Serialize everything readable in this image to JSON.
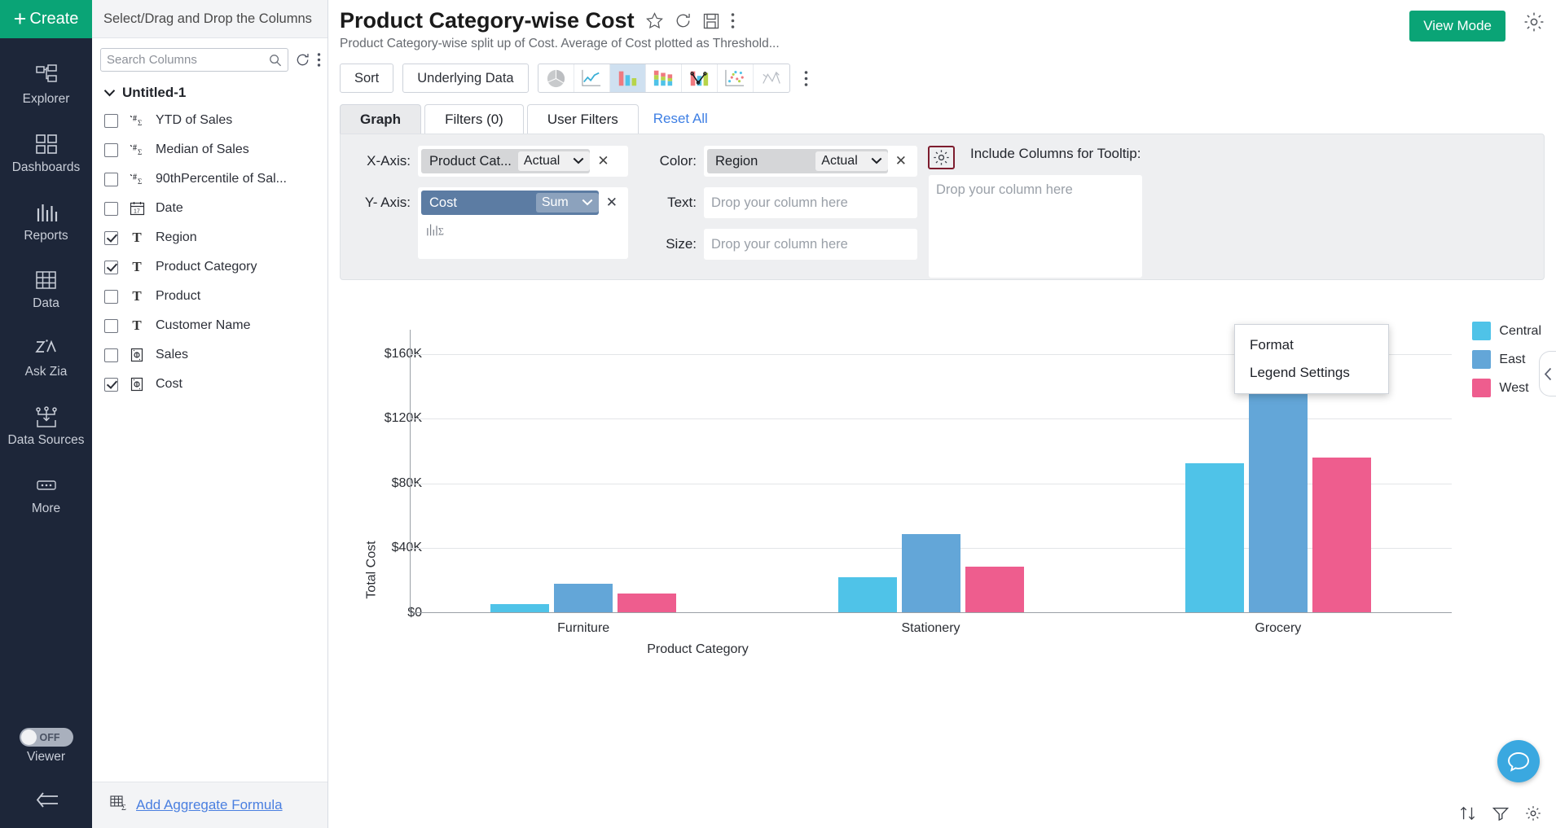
{
  "nav": {
    "create_label": "Create",
    "items": [
      {
        "label": "Explorer",
        "icon": "explorer-icon"
      },
      {
        "label": "Dashboards",
        "icon": "dashboards-icon"
      },
      {
        "label": "Reports",
        "icon": "reports-icon"
      },
      {
        "label": "Data",
        "icon": "data-icon"
      },
      {
        "label": "Ask Zia",
        "icon": "ask-zia-icon"
      },
      {
        "label": "Data Sources",
        "icon": "data-sources-icon"
      },
      {
        "label": "More",
        "icon": "more-icon"
      }
    ],
    "viewer": {
      "label": "Viewer",
      "toggle_state": "OFF"
    }
  },
  "columns_panel": {
    "header": "Select/Drag and Drop the Columns",
    "search_placeholder": "Search Columns",
    "search_value": "",
    "table_group": "Untitled-1",
    "columns": [
      {
        "label": "YTD of Sales",
        "type": "formula",
        "checked": false
      },
      {
        "label": "Median of Sales",
        "type": "formula",
        "checked": false
      },
      {
        "label": "90thPercentile of Sal...",
        "type": "formula",
        "checked": false
      },
      {
        "label": "Date",
        "type": "date",
        "checked": false
      },
      {
        "label": "Region",
        "type": "text",
        "checked": true
      },
      {
        "label": "Product Category",
        "type": "text",
        "checked": true
      },
      {
        "label": "Product",
        "type": "text",
        "checked": false
      },
      {
        "label": "Customer Name",
        "type": "text",
        "checked": false
      },
      {
        "label": "Sales",
        "type": "currency",
        "checked": false
      },
      {
        "label": "Cost",
        "type": "currency",
        "checked": true
      }
    ],
    "add_formula": "Add Aggregate Formula"
  },
  "header": {
    "title": "Product Category-wise Cost",
    "description": "Product Category-wise split up of Cost. Average of Cost plotted as Threshold...",
    "view_mode_label": "View Mode"
  },
  "toolbar": {
    "sort_label": "Sort",
    "underlying_data_label": "Underlying Data",
    "chart_types": [
      {
        "name": "pie-chart-icon",
        "active": false
      },
      {
        "name": "line-chart-icon",
        "active": false
      },
      {
        "name": "bar-chart-icon",
        "active": true
      },
      {
        "name": "stacked-bar-chart-icon",
        "active": false
      },
      {
        "name": "combo-chart-icon",
        "active": false
      },
      {
        "name": "scatter-chart-icon",
        "active": false
      },
      {
        "name": "web-chart-icon",
        "active": false
      }
    ]
  },
  "tabs": [
    {
      "label": "Graph",
      "active": true
    },
    {
      "label": "Filters  (0)",
      "active": false
    },
    {
      "label": "User Filters",
      "active": false
    }
  ],
  "reset_all": "Reset All",
  "shelves": {
    "x_axis": {
      "label": "X-Axis:",
      "column": "Product Cat...",
      "aggregate": "Actual"
    },
    "y_axis": {
      "label": "Y- Axis:",
      "column": "Cost",
      "aggregate": "Sum"
    },
    "color": {
      "label": "Color:",
      "column": "Region",
      "aggregate": "Actual"
    },
    "text": {
      "label": "Text:",
      "placeholder": "Drop your column here"
    },
    "size": {
      "label": "Size:",
      "placeholder": "Drop your column here"
    },
    "tooltip": {
      "label": "Include Columns for Tooltip:",
      "placeholder": "Drop your column here"
    }
  },
  "context_menu": {
    "items": [
      "Format",
      "Legend Settings"
    ]
  },
  "chart_data": {
    "type": "bar",
    "title": "",
    "categories": [
      "Furniture",
      "Stationery",
      "Grocery"
    ],
    "series": [
      {
        "name": "Central",
        "color": "#4FC3E8",
        "values": [
          5000,
          21500,
          92000
        ]
      },
      {
        "name": "East",
        "color": "#63A6D8",
        "values": [
          17500,
          48500,
          159000
        ]
      },
      {
        "name": "West",
        "color": "#EE5D8E",
        "values": [
          11500,
          28000,
          95500
        ]
      }
    ],
    "xlabel": "Product Category",
    "ylabel": "Total Cost",
    "yticks": [
      "$0",
      "$40K",
      "$80K",
      "$120K",
      "$160K"
    ],
    "ytick_values": [
      0,
      40000,
      80000,
      120000,
      160000
    ],
    "ylim": [
      0,
      175000
    ],
    "grid": true,
    "legend_position": "right"
  }
}
